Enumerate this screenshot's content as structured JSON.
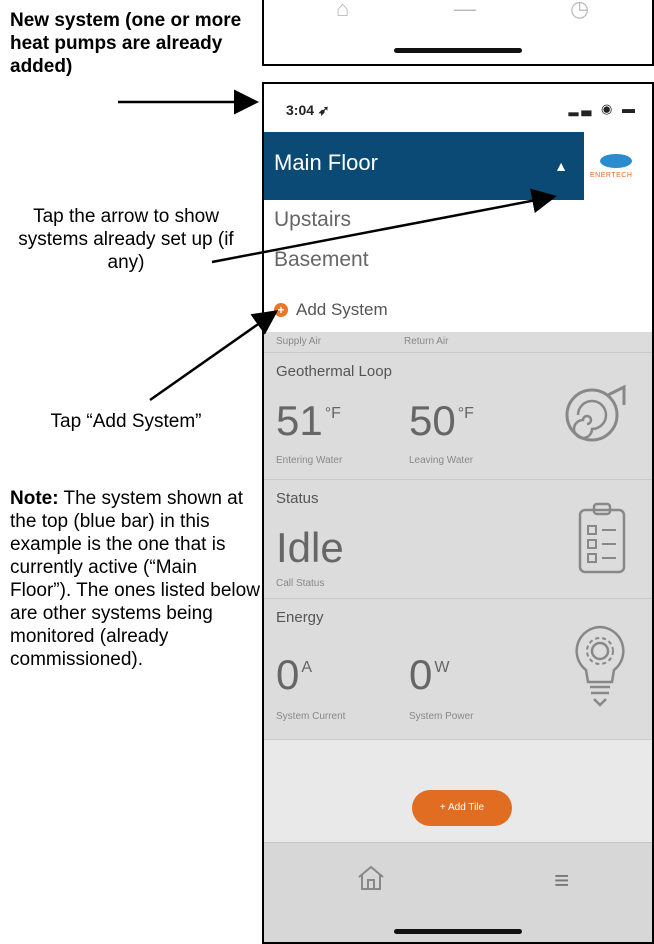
{
  "annotations": {
    "title": "New system (one or more heat pumps are already added)",
    "tap_arrow": "Tap the arrow to show systems already set up (if any)",
    "tap_add": "Tap “Add System”",
    "note_label": "Note:",
    "note_text": " The system shown at the top (blue bar) in this example is the one that is currently active (“Main Floor”). The ones listed below are other systems being monitored (already commissioned)."
  },
  "status_bar": {
    "time": "3:04",
    "icons": "signal-icon wifi-icon battery-icon"
  },
  "dropdown": {
    "selected": "Main Floor",
    "items": [
      "Upstairs",
      "Basement"
    ],
    "add_label": "Add System"
  },
  "logo": {
    "text": "ENERTECH"
  },
  "tiles": {
    "air": {
      "left_caption": "Supply Air",
      "right_caption": "Return Air"
    },
    "geo": {
      "title": "Geothermal Loop",
      "v1": "51",
      "u1": "°F",
      "c1": "Entering Water",
      "v2": "50",
      "u2": "°F",
      "c2": "Leaving Water"
    },
    "status": {
      "title": "Status",
      "value": "Idle",
      "caption": "Call Status"
    },
    "energy": {
      "title": "Energy",
      "v1": "0",
      "u1": "A",
      "c1": "System Current",
      "v2": "0",
      "u2": "W",
      "c2": "System Power"
    }
  },
  "add_tile_label": "+ Add Tile",
  "colors": {
    "header_blue": "#0b4a75",
    "accent_orange": "#e06d22"
  }
}
